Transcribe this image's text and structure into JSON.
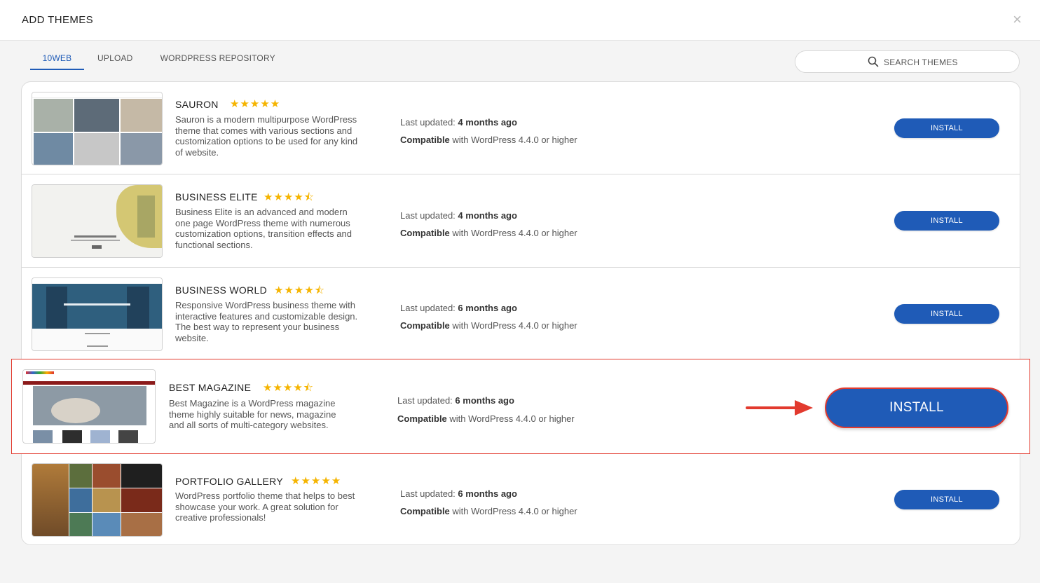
{
  "header": {
    "title": "ADD THEMES",
    "close_glyph": "×"
  },
  "tabs": [
    {
      "label": "10WEB",
      "active": true
    },
    {
      "label": "UPLOAD",
      "active": false
    },
    {
      "label": "WORDPRESS REPOSITORY",
      "active": false
    }
  ],
  "search": {
    "placeholder": "SEARCH THEMES",
    "icon": "search-icon"
  },
  "meta_labels": {
    "last_updated": "Last updated:",
    "compatible": "Compatible",
    "compat_text": " with WordPress 4.4.0 or higher"
  },
  "accent_color": "#1f5bb7",
  "highlight_color": "#e23a2e",
  "themes": [
    {
      "name": "SAURON",
      "rating": 5,
      "stars": "★★★★★",
      "description": "Sauron is a modern multipurpose WordPress theme that comes with various sections and customization options to be used for any kind of website.",
      "updated": "4 months ago",
      "install_label": "INSTALL"
    },
    {
      "name": "BUSINESS ELITE",
      "rating": 4.5,
      "stars": "★★★★⯪",
      "description": "Business Elite is an advanced and modern one page WordPress theme with numerous customization options, transition effects and functional sections.",
      "updated": "4 months ago",
      "install_label": "INSTALL"
    },
    {
      "name": "BUSINESS WORLD",
      "rating": 4.5,
      "stars": "★★★★⯪",
      "description": "Responsive WordPress business theme with interactive features and customizable design. The best way to represent your business website.",
      "updated": "6 months ago",
      "install_label": "INSTALL"
    },
    {
      "name": "BEST MAGAZINE",
      "rating": 4.5,
      "stars": "★★★★⯪",
      "description": "Best Magazine is a WordPress magazine theme highly suitable for news, magazine and all sorts of multi-category websites.",
      "updated": "6 months ago",
      "install_label": "INSTALL"
    },
    {
      "name": "PORTFOLIO GALLERY",
      "rating": 5,
      "stars": "★★★★★",
      "description": "WordPress portfolio theme that helps to best showcase your work. A great solution for creative professionals!",
      "updated": "6 months ago",
      "install_label": "INSTALL"
    }
  ]
}
